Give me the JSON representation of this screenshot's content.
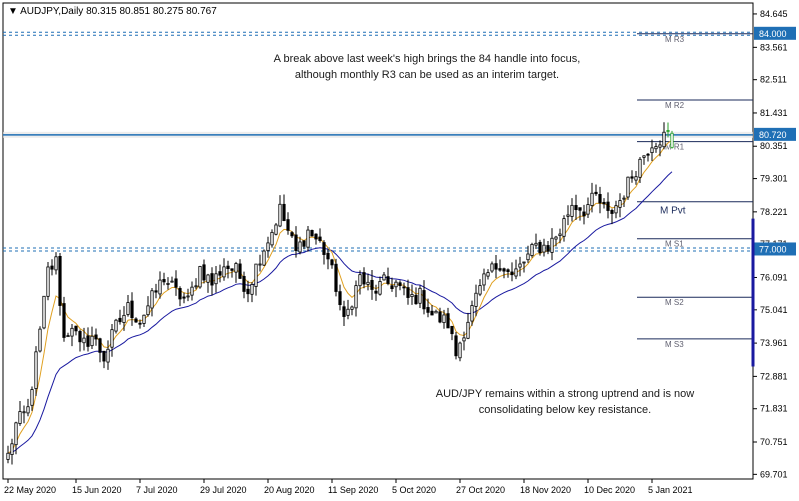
{
  "header": {
    "symbol_tf": "AUDJPY,Daily",
    "ohlc": "80.315 80.851 80.275 80.767"
  },
  "annotations": [
    "A break above last week's high brings the 84 handle into focus, although monthly R3 can be used as an interim target.",
    "AUD/JPY remains within a strong uptrend and is now consolidating below key resistance."
  ],
  "colors": {
    "ema_fast": "#e0a020",
    "ema_slow": "#1a1aa0",
    "resistance": "#1f6fb5",
    "label_box": "#1f6fb5",
    "pivot": "#1a2a5a",
    "last_candle": "#2aa02a"
  },
  "chart_data": {
    "type": "candlestick",
    "title": "AUDJPY,Daily",
    "ylim": [
      69.55,
      85.0
    ],
    "y_ticks": [
      "84.645",
      "83.561",
      "82.511",
      "81.431",
      "80.351",
      "79.301",
      "78.221",
      "77.171",
      "76.091",
      "75.041",
      "73.961",
      "72.881",
      "71.831",
      "70.751",
      "69.701"
    ],
    "x_ticks": [
      {
        "label": "22 May 2020",
        "index": 0
      },
      {
        "label": "15 Jun 2020",
        "index": 17
      },
      {
        "label": "7 Jul 2020",
        "index": 33
      },
      {
        "label": "29 Jul 2020",
        "index": 49
      },
      {
        "label": "20 Aug 2020",
        "index": 65
      },
      {
        "label": "11 Sep 2020",
        "index": 81
      },
      {
        "label": "5 Oct 2020",
        "index": 97
      },
      {
        "label": "27 Oct 2020",
        "index": 113
      },
      {
        "label": "18 Nov 2020",
        "index": 129
      },
      {
        "label": "10 Dec 2020",
        "index": 145
      },
      {
        "label": "5 Jan 2021",
        "index": 161
      }
    ],
    "horizontal_lines": [
      {
        "value": 84.0,
        "label": "84.000",
        "style": "dashed"
      },
      {
        "value": 80.72,
        "label": "80.720",
        "style": "solid"
      },
      {
        "value": 77.0,
        "label": "77.000",
        "style": "dashed"
      }
    ],
    "pivots": [
      {
        "name": "M R3",
        "value": 84.0
      },
      {
        "name": "M R2",
        "value": 81.85
      },
      {
        "name": "M R1",
        "value": 80.5
      },
      {
        "name": "M Pvt",
        "value": 78.55
      },
      {
        "name": "M S1",
        "value": 77.35
      },
      {
        "name": "M S2",
        "value": 75.45
      },
      {
        "name": "M S3",
        "value": 74.1
      }
    ],
    "close_anchors": [
      [
        0,
        70.3
      ],
      [
        2,
        71.3
      ],
      [
        5,
        71.8
      ],
      [
        8,
        74.3
      ],
      [
        10,
        76.3
      ],
      [
        12,
        76.6
      ],
      [
        14,
        74.1
      ],
      [
        16,
        74.6
      ],
      [
        18,
        73.8
      ],
      [
        21,
        74.2
      ],
      [
        24,
        73.5
      ],
      [
        27,
        74.5
      ],
      [
        30,
        75.1
      ],
      [
        33,
        74.7
      ],
      [
        36,
        75.4
      ],
      [
        39,
        76.1
      ],
      [
        42,
        75.6
      ],
      [
        45,
        75.3
      ],
      [
        48,
        76.4
      ],
      [
        51,
        75.9
      ],
      [
        54,
        76.5
      ],
      [
        57,
        76.3
      ],
      [
        60,
        75.7
      ],
      [
        63,
        76.8
      ],
      [
        66,
        77.6
      ],
      [
        68,
        78.3
      ],
      [
        70,
        77.6
      ],
      [
        72,
        76.9
      ],
      [
        75,
        77.6
      ],
      [
        78,
        77.2
      ],
      [
        80,
        76.7
      ],
      [
        82,
        75.8
      ],
      [
        84,
        74.6
      ],
      [
        86,
        75.4
      ],
      [
        88,
        76.1
      ],
      [
        91,
        75.6
      ],
      [
        94,
        75.9
      ],
      [
        97,
        75.9
      ],
      [
        100,
        75.4
      ],
      [
        103,
        75.5
      ],
      [
        106,
        74.9
      ],
      [
        110,
        74.6
      ],
      [
        112,
        73.6
      ],
      [
        114,
        74.4
      ],
      [
        117,
        75.4
      ],
      [
        120,
        76.2
      ],
      [
        123,
        76.6
      ],
      [
        126,
        76.1
      ],
      [
        129,
        76.6
      ],
      [
        132,
        77.1
      ],
      [
        135,
        77.1
      ],
      [
        138,
        77.6
      ],
      [
        141,
        78.5
      ],
      [
        144,
        78.3
      ],
      [
        147,
        78.7
      ],
      [
        150,
        78.1
      ],
      [
        153,
        78.6
      ],
      [
        156,
        79.4
      ],
      [
        159,
        80.1
      ],
      [
        161,
        80.5
      ],
      [
        163,
        80.6
      ],
      [
        166,
        80.77
      ]
    ]
  }
}
